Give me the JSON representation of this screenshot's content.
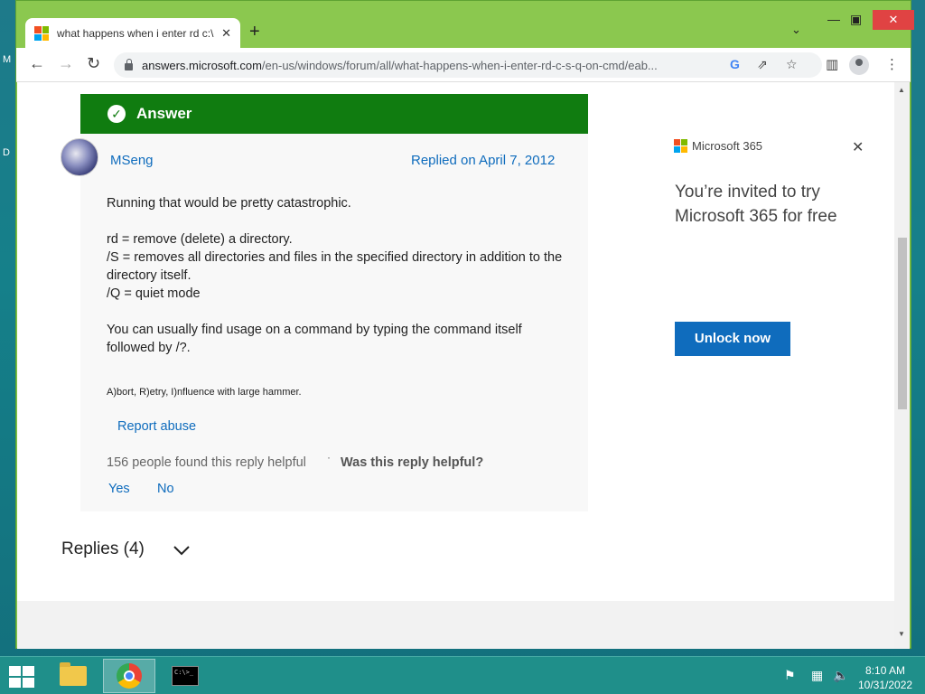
{
  "desktop": {
    "icon_label_1": "M",
    "icon_label_2": "D"
  },
  "browser": {
    "tab_title": "what happens when i enter rd c:\\",
    "tab_close": "✕",
    "new_tab": "+",
    "tab_search": "⌄",
    "minimize": "—",
    "maximize": "▣",
    "close": "✕",
    "url_host": "answers.microsoft.com",
    "url_path": "/en-us/windows/forum/all/what-happens-when-i-enter-rd-c-s-q-on-cmd/eab...",
    "omnibox_icons": {
      "google": "G",
      "share": "⇗",
      "bookmark": "☆"
    }
  },
  "answer": {
    "header": "Answer",
    "author": "MSeng",
    "replied": "Replied on April 7, 2012",
    "body": {
      "line1": "Running that would be pretty catastrophic.",
      "line2": "rd = remove (delete) a directory.",
      "line3": "/S = removes all directories and files in the specified directory in addition to the directory itself.",
      "line4": "/Q = quiet mode",
      "line5": "You can usually find usage on a command by typing the command itself followed by /?."
    },
    "signature": "A)bort, R)etry, I)nfluence with large hammer.",
    "report": "Report abuse",
    "helpful_count": "156 people found this reply helpful",
    "separator": "·",
    "helpful_question": "Was this reply helpful?",
    "yes": "Yes",
    "no": "No"
  },
  "replies": {
    "label": "Replies (4)"
  },
  "ad": {
    "brand": "Microsoft 365",
    "close": "✕",
    "headline": "You’re invited to try Microsoft 365 for free",
    "button": "Unlock now"
  },
  "taskbar": {
    "time": "8:10 AM",
    "date": "10/31/2022",
    "cmd_label": "C:\\>_"
  },
  "colors": {
    "accent_green": "#107c10",
    "link_blue": "#0f6cbd",
    "window_green": "#7fc34a"
  }
}
